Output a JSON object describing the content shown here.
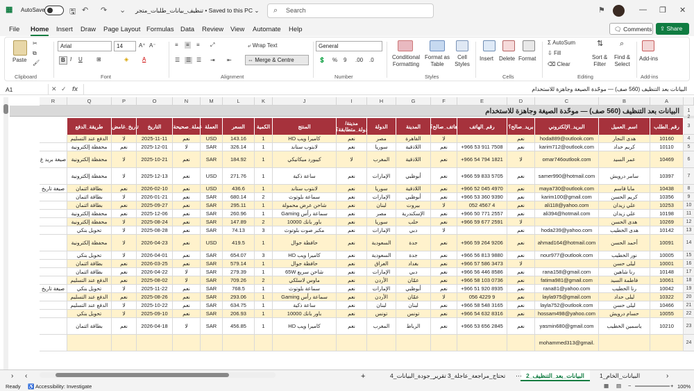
{
  "titlebar": {
    "autosave": "AutoSave",
    "off": "Off",
    "doc_title": "تنظيف_بيانات_طلبات_متجر",
    "saved": "• Saved to this PC ⌄",
    "search_placeholder": "Search"
  },
  "menu": [
    "File",
    "Home",
    "Insert",
    "Draw",
    "Page Layout",
    "Formulas",
    "Data",
    "Review",
    "View",
    "Automate",
    "Help"
  ],
  "menu_active": "Home",
  "comments": "Comments",
  "share": "Share",
  "ribbon": {
    "clipboard": "Clipboard",
    "paste": "Paste",
    "font": "Font",
    "font_name": "Arial",
    "font_size": "14",
    "alignment": "Alignment",
    "wrap_text": "Wrap Text",
    "merge_centre": "Merge & Centre",
    "number": "Number",
    "number_format": "General",
    "styles": "Styles",
    "conditional": "Conditional",
    "formatting": "Formatting",
    "format_as": "Format as",
    "table": "Table",
    "cell": "Cell",
    "cell_styles": "Styles",
    "cells": "Cells",
    "insert": "Insert",
    "delete": "Delete",
    "format": "Format",
    "editing": "Editing",
    "autosum": "AutoSum",
    "fill": "Fill",
    "clear": "Clear",
    "sort": "Sort &",
    "filter": "Filter",
    "find": "Find &",
    "select": "Select",
    "addins": "Add-ins",
    "addins_btn": "Add-ins"
  },
  "formula_bar": {
    "cell_ref": "A1",
    "fx": "fx",
    "value": "البيانات بعد التنظيف (560 صف) — موحّدة الصيغة وجاهزة للاستخدام"
  },
  "columns": [
    "A",
    "B",
    "C",
    "D",
    "E",
    "F",
    "G",
    "H",
    "I",
    "J",
    "K",
    "L",
    "M",
    "N",
    "O",
    "P",
    "Q",
    "R"
  ],
  "row_numbers": [
    "1",
    "2",
    "3",
    "4",
    "5",
    "6",
    "7",
    "8",
    "9",
    "10",
    "11",
    "12",
    "13",
    "14",
    "15",
    "16",
    "17",
    "18",
    "19",
    "20",
    "21",
    "22",
    "23",
    "24"
  ],
  "sheet_title": "البيانات بعد التنظيف (560 صف) — موحّدة الصيغة وجاهزة للاستخدام",
  "headers": [
    "رقم_الطلب",
    "اسم_العميل",
    "البريد_الإلكتروني",
    "بريد_صالح؟",
    "رقم_الهاتف",
    "هاتف_صالح؟",
    "المدينة",
    "الدولة",
    "مدينة/دولة_متطابقة؟",
    "المنتج",
    "الكمية",
    "السعر",
    "العملة",
    "عملة_صحيحة؟",
    "التاريخ",
    "تاريخ_غامض؟",
    "طريقة_الدفع"
  ],
  "rows": [
    [
      "10160",
      "هدى النجار",
      "hoda889@outlook.com",
      "نعم",
      "",
      "لا",
      "القاهرة",
      "مصر",
      "نعم",
      "كاميرا ويب HD",
      "1",
      "143.16",
      "USD",
      "نعم",
      "2025-11-11",
      "لا",
      "الدفع عند التسليم",
      ""
    ],
    [
      "10110",
      "كريم حداد",
      "karim712@outlook.com",
      "نعم",
      "+966 53 911 7508",
      "نعم",
      "اللاذقية",
      "سوريا",
      "نعم",
      "لابتوب ستاند",
      "1",
      "326.14",
      "SAR",
      "لا",
      "2025-12-01",
      "نعم",
      "محفظة إلكترونية",
      ""
    ],
    [
      "10469",
      "عمر السيد",
      "omar746outlook.com",
      "لا",
      "+966 54 794 1821",
      "نعم",
      "اللاذقية",
      "المغرب",
      "لا",
      "كيبورد ميكانيكي",
      "1",
      "184.92",
      "SAR",
      "نعم",
      "2025-10-21",
      "لا",
      "محفظة إلكترونية",
      "صيغة بريد غ"
    ],
    [
      "10397",
      "سامر درويش",
      "samer990@hotmail.com",
      "نعم",
      "+966 59 833 5705",
      "نعم",
      "أبوظبي",
      "الإمارات",
      "نعم",
      "ساعة ذكية",
      "1",
      "271.76",
      "USD",
      "نعم",
      "2025-12-13",
      "لا",
      "محفظة إلكترونية",
      ""
    ],
    [
      "10438",
      "مايا قاسم",
      "maya730@outlook.com",
      "نعم",
      "+966 52 045 4970",
      "نعم",
      "اللاذقية",
      "سوريا",
      "نعم",
      "لابتوب ستاند",
      "1",
      "436.6",
      "USD",
      "نعم",
      "2026-02-10",
      "نعم",
      "بطاقة ائتمان",
      "صيغة تاريخ"
    ],
    [
      "10356",
      "كريم الحسن",
      "karim100@gmail.com",
      "نعم",
      "+966 53 360 9390",
      "نعم",
      "أبوظبي",
      "الإمارات",
      "نعم",
      "سماعة بلوتوث",
      "2",
      "680.14",
      "SAR",
      "نعم",
      "2026-01-21",
      "لا",
      "بطاقة ائتمان",
      ""
    ],
    [
      "10253",
      "علي زيدان",
      "ali118@yahoo.com",
      "نعم",
      "052 4567 4",
      "لا",
      "بيروت",
      "لبنان",
      "نعم",
      "شاحن عرض محمولة",
      "1",
      "295.11",
      "SAR",
      "نعم",
      "2025-09-27",
      "نعم",
      "بطاقة ائتمان",
      ""
    ],
    [
      "10198",
      "علي زيدان",
      "ali394@hotmail.com",
      "نعم",
      "+966 50 771 2557",
      "نعم",
      "الإسكندرية",
      "مصر",
      "نعم",
      "سماعة رأس Gaming",
      "1",
      "260.96",
      "SAR",
      "نعم",
      "2025-12-06",
      "نعم",
      "محفظة إلكترونية",
      ""
    ],
    [
      "10269",
      "هدى الحسن",
      "",
      "لا",
      "+966 59 677 2591",
      "نعم",
      "حلب",
      "سوريا",
      "نعم",
      "باور بانك 10000",
      "2",
      "147.89",
      "SAR",
      "نعم",
      "2025-08-24",
      "لا",
      "محفظة إلكترونية",
      ""
    ],
    [
      "10142",
      "هدى الخطيب",
      "hoda239@yahoo.com",
      "نعم",
      "",
      "لا",
      "دبي",
      "الإمارات",
      "نعم",
      "مكبر صوت بلوتوث",
      "3",
      "74.13",
      "SAR",
      "نعم",
      "2025-08-28",
      "لا",
      "تحويل بنكي",
      ""
    ],
    [
      "10091",
      "أحمد الحسن",
      "ahmad164@hotmail.com",
      "نعم",
      "+966 59 264 9206",
      "نعم",
      "جدة",
      "السعودية",
      "نعم",
      "حافظة جوال",
      "1",
      "419.5",
      "USD",
      "نعم",
      "2026-04-23",
      "لا",
      "محفظة إلكترونية",
      ""
    ],
    [
      "10005",
      "نور الخطيب",
      "nour977@outlook.com",
      "نعم",
      "+966 56 813 9880",
      "نعم",
      "جدة",
      "السعودية",
      "نعم",
      "كاميرا ويب HD",
      "3",
      "654.07",
      "SAR",
      "نعم",
      "2026-04-01",
      "لا",
      "تحويل بنكي",
      ""
    ],
    [
      "10001",
      "ليلى حسن",
      "",
      "لا",
      "+966 57 586 3473",
      "نعم",
      "بغداد",
      "العراق",
      "نعم",
      "حافظة جوال",
      "1",
      "579.14",
      "SAR",
      "نعم",
      "2026-03-25",
      "نعم",
      "بطاقة ائتمان",
      ""
    ],
    [
      "10148",
      "رنا شاهين",
      "rana158@gmail.com",
      "نعم",
      "+966 56 446 8586",
      "نعم",
      "دبي",
      "الإمارات",
      "نعم",
      "شاحن سريع 65W",
      "1",
      "279.39",
      "SAR",
      "لا",
      "2026-04-22",
      "نعم",
      "بطاقة ائتمان",
      ""
    ],
    [
      "10061",
      "فاطمة السيد",
      "fatima981@gmail.com",
      "نعم",
      "+966 58 103 0736",
      "نعم",
      "عمّان",
      "الأردن",
      "نعم",
      "ماوس لاسلكي",
      "2",
      "709.26",
      "SAR",
      "لا",
      "2025-08-02",
      "نعم",
      "الدفع عند التسليم",
      ""
    ],
    [
      "10042",
      "رنا الخطيب",
      "rana81@yahoo.com",
      "نعم",
      "+966 51 920 8935",
      "نعم",
      "أبوظبي",
      "الإمارات",
      "نعم",
      "سماعة بلوتوث",
      "1",
      "768.5",
      "SAR",
      "نعم",
      "2025-11-22",
      "لا",
      "تحويل بنكي",
      "صيغة تاريخ"
    ],
    [
      "10322",
      "ليلى حداد",
      "layla975@gmail.com",
      "نعم",
      "056 4229 9",
      "لا",
      "عمّان",
      "الأردن",
      "نعم",
      "سماعة رأس Gaming",
      "1",
      "293.06",
      "SAR",
      "نعم",
      "2025-08-26",
      "نعم",
      "الدفع عند التسليم",
      ""
    ],
    [
      "10466",
      "ليلى حسن",
      "layla752@outlook.com",
      "نعم",
      "+966 58 548 3165",
      "نعم",
      "لبنان",
      "لبنان",
      "نعم",
      "ساعة ذكية",
      "1",
      "634.75",
      "SAR",
      "نعم",
      "2025-10-22",
      "لا",
      "الدفع عند التسليم",
      ""
    ],
    [
      "10055",
      "حسام درويش",
      "hossam498@yahoo.com",
      "نعم",
      "+966 54 632 8316",
      "نعم",
      "تونس",
      "تونس",
      "نعم",
      "باور بانك 10000",
      "1",
      "206.93",
      "SAR",
      "نعم",
      "2025-09-10",
      "لا",
      "تحويل بنكي",
      ""
    ],
    [
      "10210",
      "ياسمين الخطيب",
      "yasmin680@gmail.com",
      "نعم",
      "+966 53 656 2845",
      "نعم",
      "الرباط",
      "المغرب",
      "نعم",
      "كاميرا ويب HD",
      "1",
      "456.85",
      "SAR",
      "لا",
      "2026-04-18",
      "نعم",
      "بطاقة ائتمان",
      ""
    ],
    [
      "",
      "",
      "mohammed313@gmail.",
      "",
      "",
      "",
      "",
      "",
      "",
      "",
      "",
      "",
      "",
      "",
      "",
      "",
      "",
      ""
    ]
  ],
  "tabs": [
    "البيانات_الخام_1",
    "البيانات_بعد_التنظيف_2",
    "تحتاج_مراجعة_عاجلة_3",
    "تقرير_جودة_البيانات_4"
  ],
  "active_tab": "البيانات_بعد_التنظيف_2",
  "status": {
    "ready": "Ready",
    "accessibility": "Accessibility: Investigate",
    "zoom": "100%"
  }
}
